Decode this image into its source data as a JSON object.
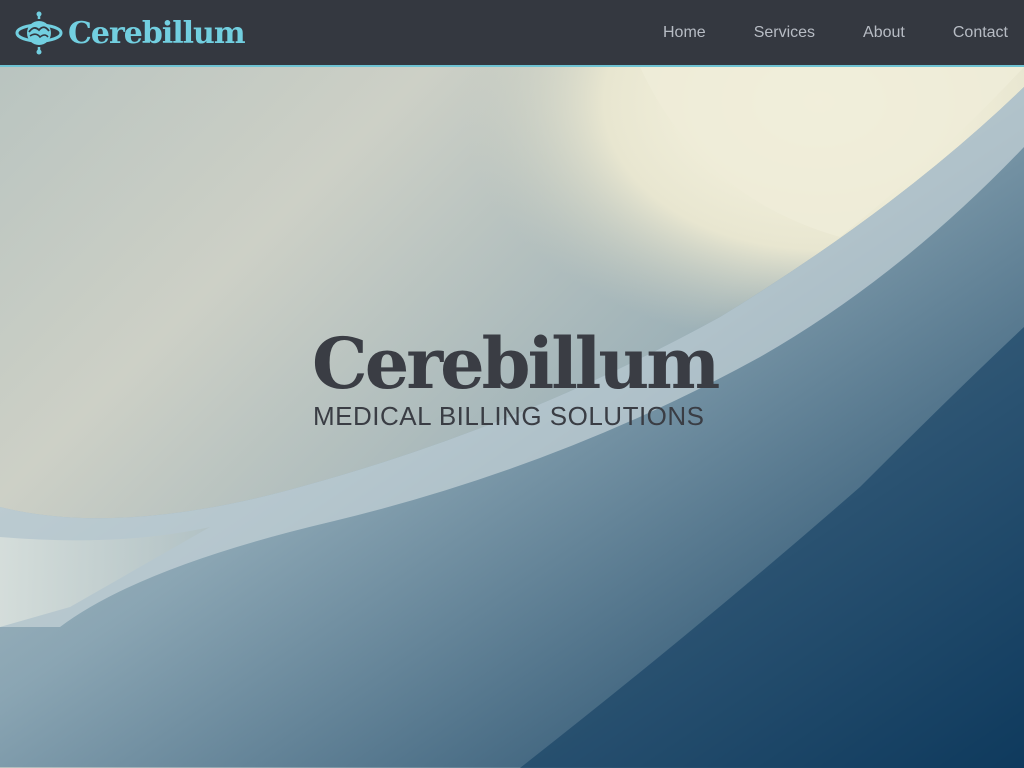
{
  "header": {
    "brand_name": "Cerebillum",
    "logo_icon": "brain-globe-logo-icon",
    "nav": [
      {
        "label": "Home"
      },
      {
        "label": "Services"
      },
      {
        "label": "About"
      },
      {
        "label": "Contact"
      }
    ]
  },
  "hero": {
    "title": "Cerebillum",
    "subtitle": "MEDICAL BILLING SOLUTIONS"
  },
  "colors": {
    "navbar_bg": "#343840",
    "brand_accent": "#72cfe0",
    "nav_text": "#b7bcc4",
    "hero_text": "#3a3d44"
  }
}
